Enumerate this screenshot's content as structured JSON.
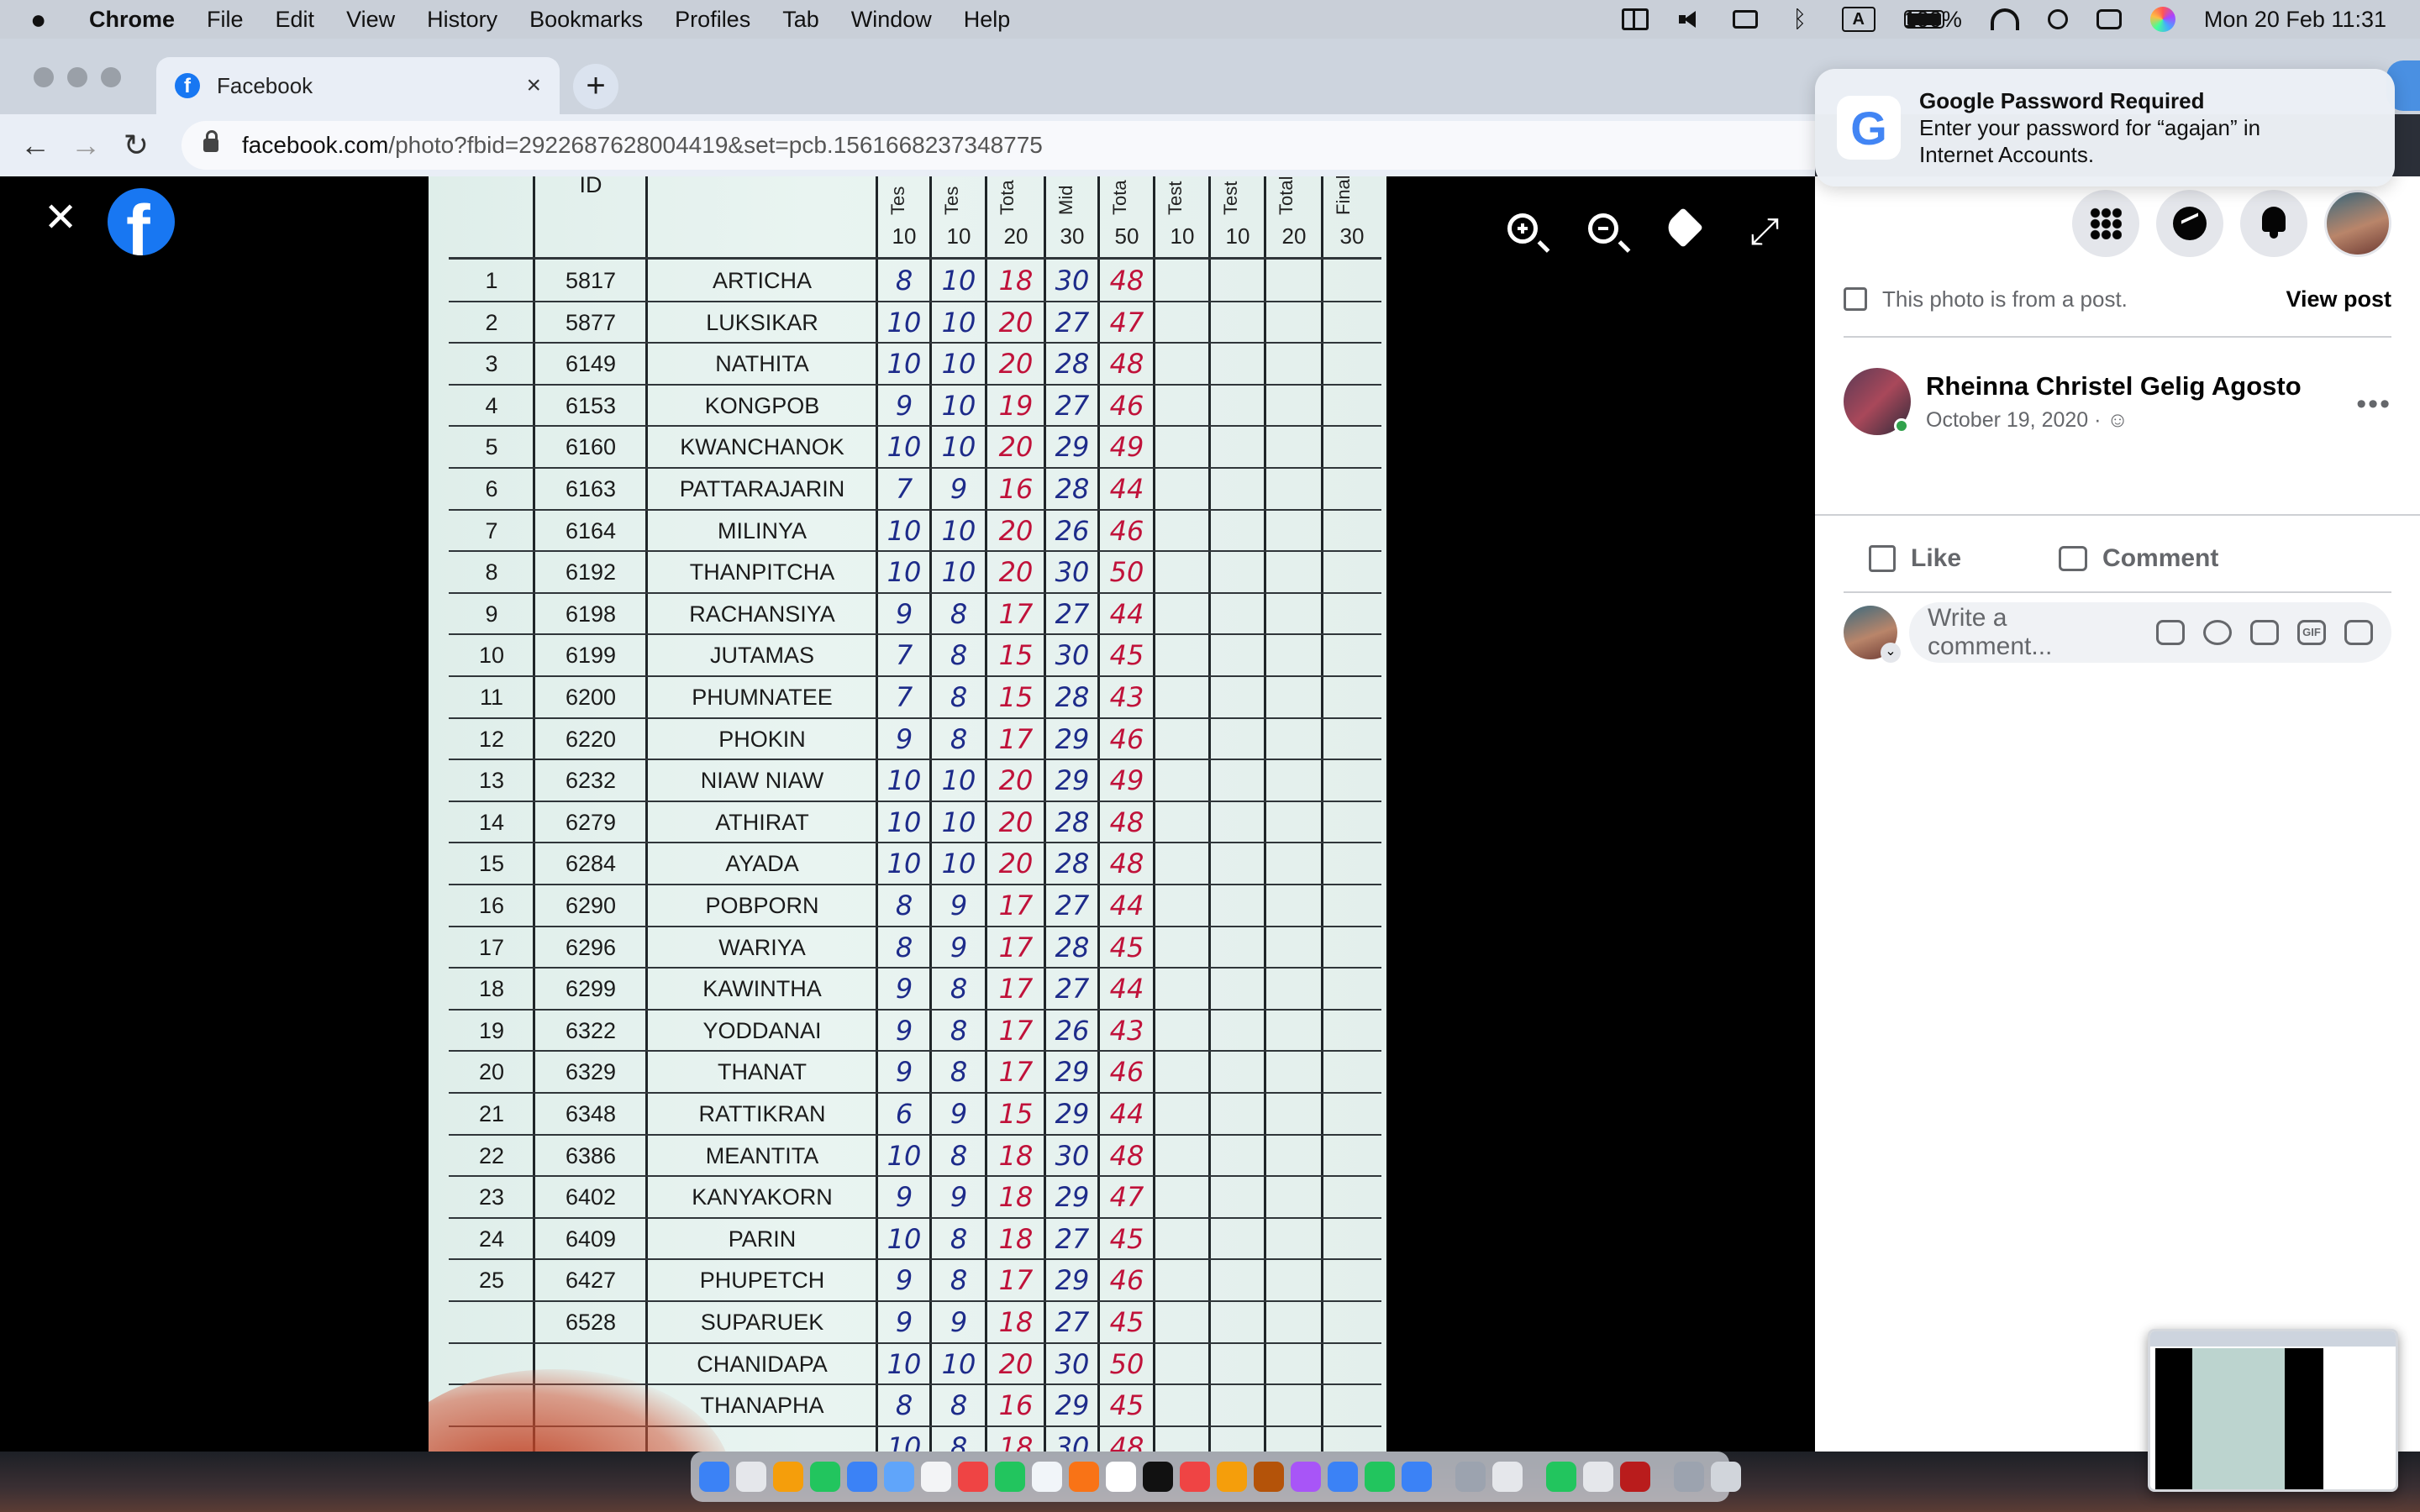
{
  "menubar": {
    "app": "Chrome",
    "items": [
      "File",
      "Edit",
      "View",
      "History",
      "Bookmarks",
      "Profiles",
      "Tab",
      "Window",
      "Help"
    ],
    "keyboard": "A",
    "battery": "100%",
    "datetime": "Mon 20 Feb  11:31"
  },
  "browser": {
    "tab_title": "Facebook",
    "url_host": "facebook.com",
    "url_path": "/photo?fbid=2922687628004419&set=pcb.1561668237348775"
  },
  "notification": {
    "logo": "G",
    "title": "Google Password Required",
    "body_line1": "Enter your password for “agajan” in",
    "body_line2": "Internet Accounts."
  },
  "viewer": {
    "close_glyph": "✕",
    "logo_letter": "f",
    "expand_glyph": "⤢"
  },
  "sheet": {
    "id_header": "ID",
    "col_headers": [
      "Tes",
      "Tes",
      "Tota",
      "Mid",
      "Tota",
      "Test",
      "Test",
      "Total",
      "Final"
    ],
    "max_values": [
      "10",
      "10",
      "20",
      "30",
      "50",
      "10",
      "10",
      "20",
      "30"
    ],
    "rows": [
      {
        "no": "1",
        "id": "5817",
        "name": "ARTICHA",
        "t1": "8",
        "t2": "10",
        "tot": "18",
        "mid": "30",
        "total": "48"
      },
      {
        "no": "2",
        "id": "5877",
        "name": "LUKSIKAR",
        "t1": "10",
        "t2": "10",
        "tot": "20",
        "mid": "27",
        "total": "47"
      },
      {
        "no": "3",
        "id": "6149",
        "name": "NATHITA",
        "t1": "10",
        "t2": "10",
        "tot": "20",
        "mid": "28",
        "total": "48"
      },
      {
        "no": "4",
        "id": "6153",
        "name": "KONGPOB",
        "t1": "9",
        "t2": "10",
        "tot": "19",
        "mid": "27",
        "total": "46"
      },
      {
        "no": "5",
        "id": "6160",
        "name": "KWANCHANOK",
        "t1": "10",
        "t2": "10",
        "tot": "20",
        "mid": "29",
        "total": "49"
      },
      {
        "no": "6",
        "id": "6163",
        "name": "PATTARAJARIN",
        "t1": "7",
        "t2": "9",
        "tot": "16",
        "mid": "28",
        "total": "44"
      },
      {
        "no": "7",
        "id": "6164",
        "name": "MILINYA",
        "t1": "10",
        "t2": "10",
        "tot": "20",
        "mid": "26",
        "total": "46"
      },
      {
        "no": "8",
        "id": "6192",
        "name": "THANPITCHA",
        "t1": "10",
        "t2": "10",
        "tot": "20",
        "mid": "30",
        "total": "50"
      },
      {
        "no": "9",
        "id": "6198",
        "name": "RACHANSIYA",
        "t1": "9",
        "t2": "8",
        "tot": "17",
        "mid": "27",
        "total": "44"
      },
      {
        "no": "10",
        "id": "6199",
        "name": "JUTAMAS",
        "t1": "7",
        "t2": "8",
        "tot": "15",
        "mid": "30",
        "total": "45"
      },
      {
        "no": "11",
        "id": "6200",
        "name": "PHUMNATEE",
        "t1": "7",
        "t2": "8",
        "tot": "15",
        "mid": "28",
        "total": "43"
      },
      {
        "no": "12",
        "id": "6220",
        "name": "PHOKIN",
        "t1": "9",
        "t2": "8",
        "tot": "17",
        "mid": "29",
        "total": "46"
      },
      {
        "no": "13",
        "id": "6232",
        "name": "NIAW  NIAW",
        "t1": "10",
        "t2": "10",
        "tot": "20",
        "mid": "29",
        "total": "49"
      },
      {
        "no": "14",
        "id": "6279",
        "name": "ATHIRAT",
        "t1": "10",
        "t2": "10",
        "tot": "20",
        "mid": "28",
        "total": "48"
      },
      {
        "no": "15",
        "id": "6284",
        "name": "AYADA",
        "t1": "10",
        "t2": "10",
        "tot": "20",
        "mid": "28",
        "total": "48"
      },
      {
        "no": "16",
        "id": "6290",
        "name": "POBPORN",
        "t1": "8",
        "t2": "9",
        "tot": "17",
        "mid": "27",
        "total": "44"
      },
      {
        "no": "17",
        "id": "6296",
        "name": "WARIYA",
        "t1": "8",
        "t2": "9",
        "tot": "17",
        "mid": "28",
        "total": "45"
      },
      {
        "no": "18",
        "id": "6299",
        "name": "KAWINTHA",
        "t1": "9",
        "t2": "8",
        "tot": "17",
        "mid": "27",
        "total": "44"
      },
      {
        "no": "19",
        "id": "6322",
        "name": "YODDANAI",
        "t1": "9",
        "t2": "8",
        "tot": "17",
        "mid": "26",
        "total": "43"
      },
      {
        "no": "20",
        "id": "6329",
        "name": "THANAT",
        "t1": "9",
        "t2": "8",
        "tot": "17",
        "mid": "29",
        "total": "46"
      },
      {
        "no": "21",
        "id": "6348",
        "name": "RATTIKRAN",
        "t1": "6",
        "t2": "9",
        "tot": "15",
        "mid": "29",
        "total": "44"
      },
      {
        "no": "22",
        "id": "6386",
        "name": "MEANTITA",
        "t1": "10",
        "t2": "8",
        "tot": "18",
        "mid": "30",
        "total": "48"
      },
      {
        "no": "23",
        "id": "6402",
        "name": "KANYAKORN",
        "t1": "9",
        "t2": "9",
        "tot": "18",
        "mid": "29",
        "total": "47"
      },
      {
        "no": "24",
        "id": "6409",
        "name": "PARIN",
        "t1": "10",
        "t2": "8",
        "tot": "18",
        "mid": "27",
        "total": "45"
      },
      {
        "no": "25",
        "id": "6427",
        "name": "PHUPETCH",
        "t1": "9",
        "t2": "8",
        "tot": "17",
        "mid": "29",
        "total": "46"
      },
      {
        "no": "",
        "id": "6528",
        "name": "SUPARUEK",
        "t1": "9",
        "t2": "9",
        "tot": "18",
        "mid": "27",
        "total": "45"
      },
      {
        "no": "",
        "id": "",
        "name": "CHANIDAPA",
        "t1": "10",
        "t2": "10",
        "tot": "20",
        "mid": "30",
        "total": "50"
      },
      {
        "no": "",
        "id": "",
        "name": "THANAPHA",
        "t1": "8",
        "t2": "8",
        "tot": "16",
        "mid": "29",
        "total": "45"
      },
      {
        "no": "",
        "id": "",
        "name": "",
        "t1": "10",
        "t2": "8",
        "tot": "18",
        "mid": "30",
        "total": "48"
      }
    ]
  },
  "panel": {
    "post_note": "This photo is from a post.",
    "view_post": "View post",
    "author": "Rheinna Christel Gelig Agosto",
    "date": "October 19, 2020 · ",
    "privacy_glyph": "☺",
    "more_glyph": "•••",
    "like": "Like",
    "comment": "Comment",
    "comment_placeholder": "Write a comment...",
    "gif_label": "GIF",
    "chevron_glyph": "⌄"
  },
  "colors": {
    "facebook_blue": "#1877f2",
    "ink_blue": "#1d2b8a",
    "ink_red": "#c0123a"
  }
}
